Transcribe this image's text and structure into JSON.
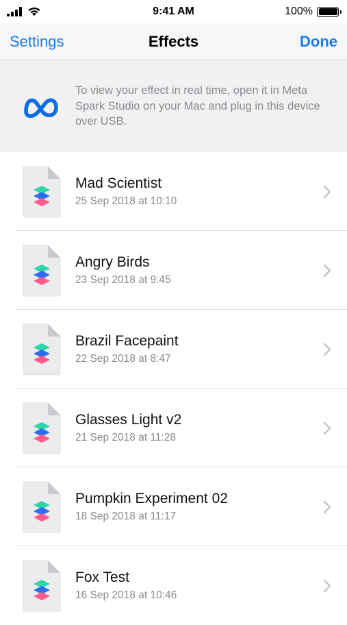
{
  "status": {
    "time": "9:41 AM",
    "battery": "100%"
  },
  "nav": {
    "back_label": "Settings",
    "title": "Effects",
    "done_label": "Done"
  },
  "banner": {
    "text": "To view your effect in real time, open it in Meta Spark Studio on your Mac and plug in this device over USB."
  },
  "effects": [
    {
      "name": "Mad Scientist",
      "date": "25 Sep 2018 at 10:10"
    },
    {
      "name": "Angry Birds",
      "date": "23 Sep 2018 at 9:45"
    },
    {
      "name": "Brazil Facepaint",
      "date": "22 Sep 2018 at 8:47"
    },
    {
      "name": "Glasses Light v2",
      "date": "21 Sep 2018 at 11:28"
    },
    {
      "name": "Pumpkin Experiment 02",
      "date": "18 Sep 2018 at 11:17"
    },
    {
      "name": "Fox Test",
      "date": "16 Sep 2018 at 10:46"
    }
  ],
  "colors": {
    "accent": "#1a7cde",
    "meta_logo": "#0a6de6",
    "spark_teal": "#2fd6a8",
    "spark_blue": "#2b6ff0",
    "spark_pink": "#ff5a8a"
  },
  "icons": {
    "file": "spark-ar-file-icon",
    "chevron": "chevron-right-icon",
    "logo": "meta-logo-icon"
  }
}
